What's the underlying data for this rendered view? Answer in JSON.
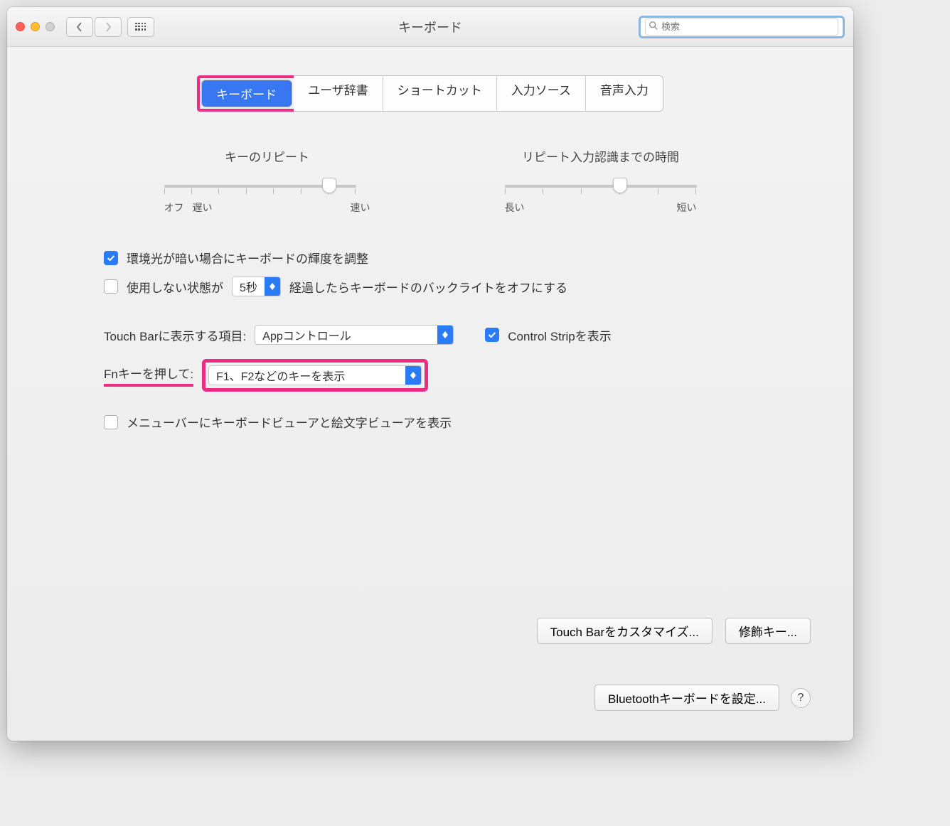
{
  "titlebar": {
    "title": "キーボード",
    "search_placeholder": "検索"
  },
  "tabs": {
    "keyboard": "キーボード",
    "user_dictionary": "ユーザ辞書",
    "shortcuts": "ショートカット",
    "input_sources": "入力ソース",
    "dictation": "音声入力"
  },
  "sliders": {
    "key_repeat": {
      "title": "キーのリピート",
      "off": "オフ",
      "slow": "遅い",
      "fast": "速い"
    },
    "delay_until_repeat": {
      "title": "リピート入力認識までの時間",
      "long": "長い",
      "short": "短い"
    }
  },
  "options": {
    "adjust_brightness": "環境光が暗い場合にキーボードの輝度を調整",
    "backlight_prefix": "使用しない状態が",
    "backlight_seconds": "5秒",
    "backlight_suffix": "経過したらキーボードのバックライトをオフにする",
    "touchbar_label": "Touch Barに表示する項目:",
    "touchbar_value": "Appコントロール",
    "control_strip": "Control Stripを表示",
    "fn_label": "Fnキーを押して:",
    "fn_value": "F1、F2などのキーを表示",
    "menubar_viewers": "メニューバーにキーボードビューアと絵文字ビューアを表示"
  },
  "buttons": {
    "customize_touchbar": "Touch Barをカスタマイズ...",
    "modifier_keys": "修飾キー...",
    "bluetooth_setup": "Bluetoothキーボードを設定...",
    "help": "?"
  }
}
